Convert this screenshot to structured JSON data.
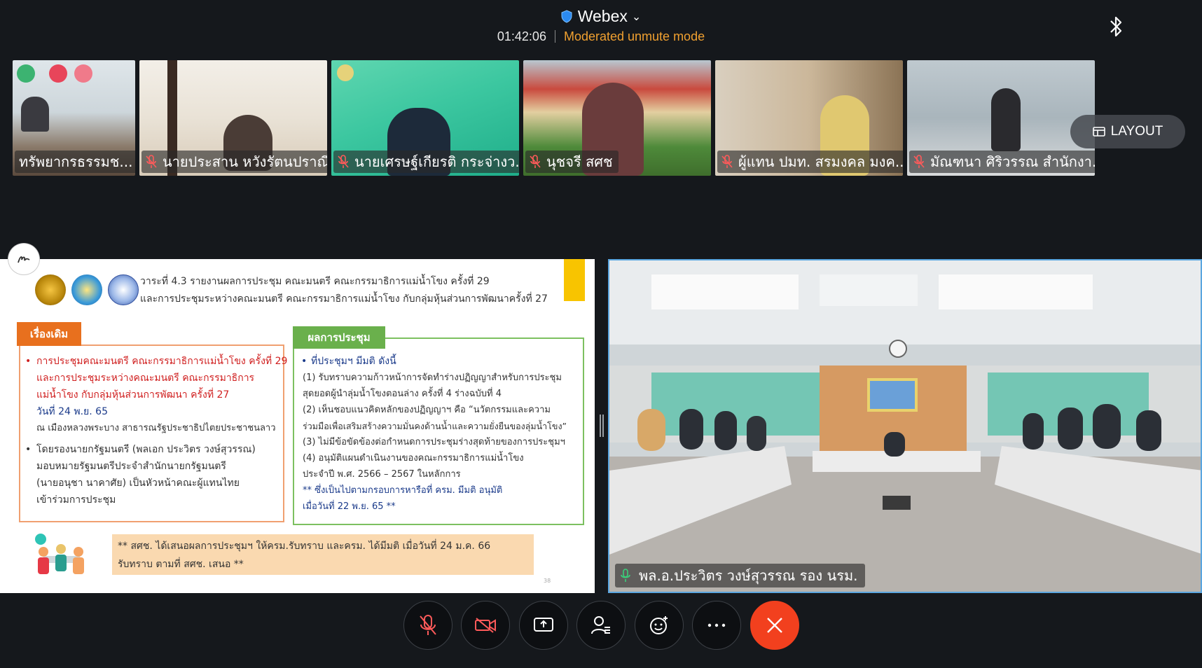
{
  "header": {
    "app_name": "Webex",
    "timer": "01:42:06",
    "mode": "Moderated unmute mode"
  },
  "thumbnails": [
    {
      "name": "ทรัพยากรธรรมช...",
      "muted": false
    },
    {
      "name": "นายประสาน หวังรัตนปราณี",
      "muted": true
    },
    {
      "name": "นายเศรษฐ์เกียรติ กระจ่างว...",
      "muted": true
    },
    {
      "name": "นุชจรี สศช",
      "muted": true
    },
    {
      "name": "ผู้แทน ปมท. สรมงคล มงค...",
      "muted": true
    },
    {
      "name": "มัณฑนา ศิริวรรณ สำนักงา...",
      "muted": true
    }
  ],
  "layout_button": "LAYOUT",
  "slide": {
    "heading_line1": "วาระที่ 4.3  รายงานผลการประชุม คณะมนตรี คณะกรรมาธิการแม่น้ำโขง ครั้งที่ 29",
    "heading_line2": "และการประชุมระหว่างคณะมนตรี คณะกรรมาธิการแม่น้ำโขง กับกลุ่มหุ้นส่วนการพัฒนาครั้งที่ 27",
    "left_tag": "เรื่องเดิม",
    "left_lines": [
      "การประชุมคณะมนตรี คณะกรรมาธิการแม่น้ำโขง ครั้งที่ 29",
      "และการประชุมระหว่างคณะมนตรี คณะกรรมาธิการ",
      "แม่น้ำโขง กับกลุ่มหุ้นส่วนการพัฒนา ครั้งที่ 27",
      "วันที่ 24 พ.ย. 65",
      "ณ เมืองหลวงพระบาง สาธารณรัฐประชาธิปไตยประชาชนลาว",
      "โดยรองนายกรัฐมนตรี (พลเอก ประวิตร วงษ์สุวรรณ)",
      "มอบหมายรัฐมนตรีประจำสำนักนายกรัฐมนตรี",
      "(นายอนุชา นาคาศัย) เป็นหัวหน้าคณะผู้แทนไทย",
      "เข้าร่วมการประชุม"
    ],
    "right_tag": "ผลการประชุม",
    "right_lines": [
      "ที่ประชุมฯ มีมติ ดังนี้",
      "(1) รับทราบความก้าวหน้าการจัดทำร่างปฏิญญาสำหรับการประชุม",
      "สุดยอดผู้นำลุ่มน้ำโขงตอนล่าง ครั้งที่ 4 ร่างฉบับที่ 4",
      "(2) เห็นชอบแนวคิดหลักของปฏิญญาฯ คือ “นวัตกรรมและความ",
      "ร่วมมือเพื่อเสริมสร้างความมั่นคงด้านน้ำและความยั่งยืนของลุ่มน้ำโขง”",
      "(3) ไม่มีข้อขัดข้องต่อกำหนดการประชุมร่างสุดท้ายของการประชุมฯ",
      "(4) อนุมัติแผนดำเนินงานของคณะกรรมาธิการแม่น้ำโขง",
      "ประจำปี พ.ศ. 2566 – 2567 ในหลักการ",
      "** ซึ่งเป็นไปตามกรอบการหารือที่ ครม. มีมติ อนุมัติ",
      "เมื่อวันที่ 22 พ.ย. 65 **"
    ],
    "note_line1": "** สศช. ได้เสนอผลการประชุมฯ ให้ครม.รับทราบ และครม. ได้มีมติ เมื่อวันที่ 24 ม.ค. 66",
    "note_line2": "รับทราบ ตามที่ สศช. เสนอ **",
    "page_number": "38"
  },
  "main_video": {
    "name": "พล.อ.ประวิตร วงษ์สุวรรณ รอง นรม."
  },
  "controls": [
    "mute",
    "stop-video",
    "share",
    "participants",
    "reactions",
    "more",
    "end-call"
  ],
  "colors": {
    "mode": "#f0a030",
    "end_call": "#f2401e",
    "active_speaker_border": "#5aa6e0"
  }
}
